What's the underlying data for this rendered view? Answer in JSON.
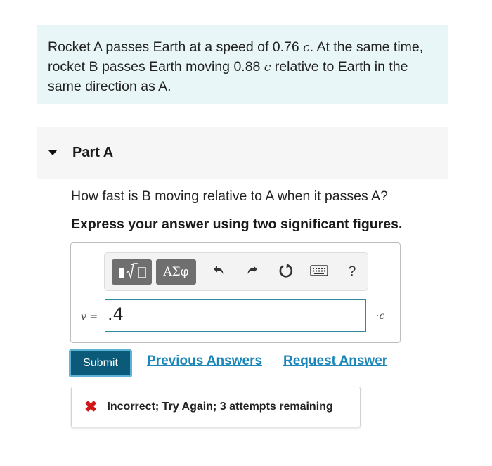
{
  "problem": {
    "seg1": "Rocket A passes Earth at a speed of 0.76 ",
    "var1": "c",
    "seg2": ". At the same time, rocket B passes Earth moving 0.88 ",
    "var2": "c",
    "seg3": " relative to Earth in the same direction as A."
  },
  "part": {
    "title": "Part A",
    "expanded": true
  },
  "question": "How fast is B moving relative to A when it passes A?",
  "instruction": "Express your answer using two significant figures.",
  "toolbar": {
    "greek_label": "ΑΣφ",
    "help_label": "?",
    "icons": [
      "template-icon",
      "greek-letters",
      "undo-icon",
      "redo-icon",
      "reset-icon",
      "keyboard-icon",
      "help-icon"
    ]
  },
  "answer": {
    "var_name": "v",
    "equals": " =",
    "value": ".4",
    "unit_prefix": "·",
    "unit": "c"
  },
  "actions": {
    "submit": "Submit",
    "previous_answers": "Previous Answers",
    "request_answer": "Request Answer"
  },
  "feedback": {
    "icon": "x-icon",
    "text": "Incorrect; Try Again; 3 attempts remaining"
  },
  "colors": {
    "problem_bg": "#e9f6f7",
    "submit_bg": "#0b5a7a",
    "link": "#1a86b9",
    "input_border": "#2e8a9b",
    "error": "#d01818"
  }
}
